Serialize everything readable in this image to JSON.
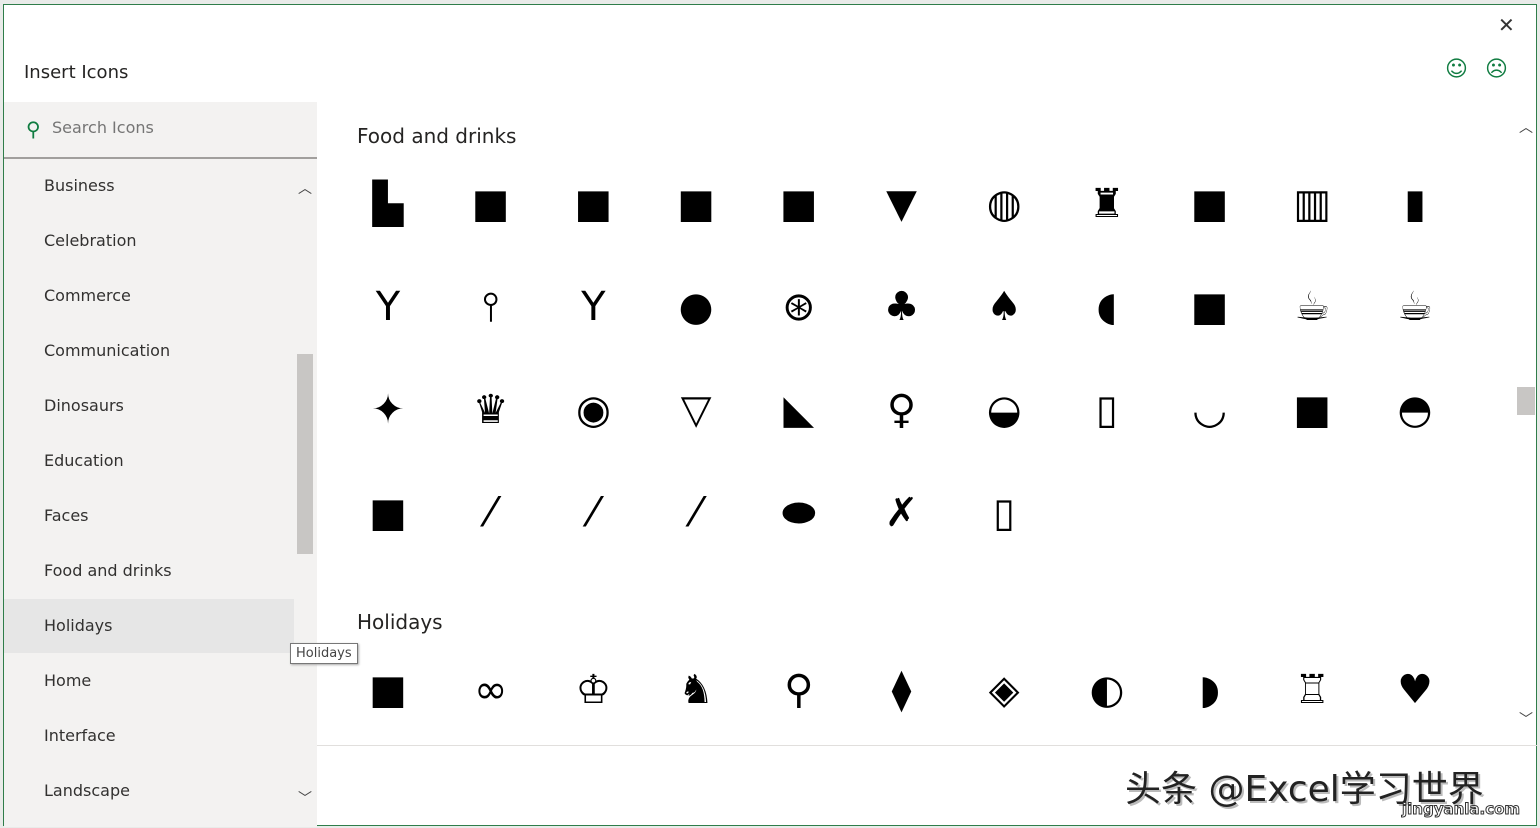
{
  "dialog": {
    "title": "Insert Icons",
    "close_icon": "close-icon",
    "feedback": [
      "smile-icon",
      "frown-icon"
    ]
  },
  "search": {
    "placeholder": "Search Icons"
  },
  "categories": [
    "Business",
    "Celebration",
    "Commerce",
    "Communication",
    "Dinosaurs",
    "Education",
    "Faces",
    "Food and drinks",
    "Holidays",
    "Home",
    "Interface",
    "Landscape"
  ],
  "selected_category": "Holidays",
  "tooltip": "Holidays",
  "sections": [
    {
      "title": "Food and drinks",
      "icons": [
        "fast-food",
        "hot-dog",
        "taco",
        "chicken-leg",
        "noodles",
        "pizza-slice",
        "pizza",
        "popcorn",
        "sushi",
        "beer-mug",
        "bottle",
        "wine-glass",
        "champagne-flute",
        "martini",
        "apple",
        "citrus-slice",
        "cherries",
        "grapes",
        "watermelon",
        "avocado",
        "hot-drink",
        "coffee-mug",
        "candy",
        "cupcake",
        "donut",
        "ice-cream-cone",
        "cake-slice",
        "lollipop",
        "pie",
        "popsicle",
        "bowl",
        "fruit-bowl",
        "cloche",
        "plate-with-cutlery",
        "fork",
        "knife",
        "spoon",
        "plate",
        "crossed-fork-knife",
        "baby-bottle"
      ]
    },
    {
      "title": "Holidays",
      "icons": [
        "champagne-toast",
        "mask",
        "jester-hat",
        "dragon",
        "wind-chime",
        "firecracker",
        "lantern",
        "fortune-cookie",
        "fan",
        "kadomatsu",
        "heart-lock"
      ]
    }
  ],
  "watermark": {
    "text": "头条 @Excel学习世界",
    "site": "jingyanla.com"
  }
}
